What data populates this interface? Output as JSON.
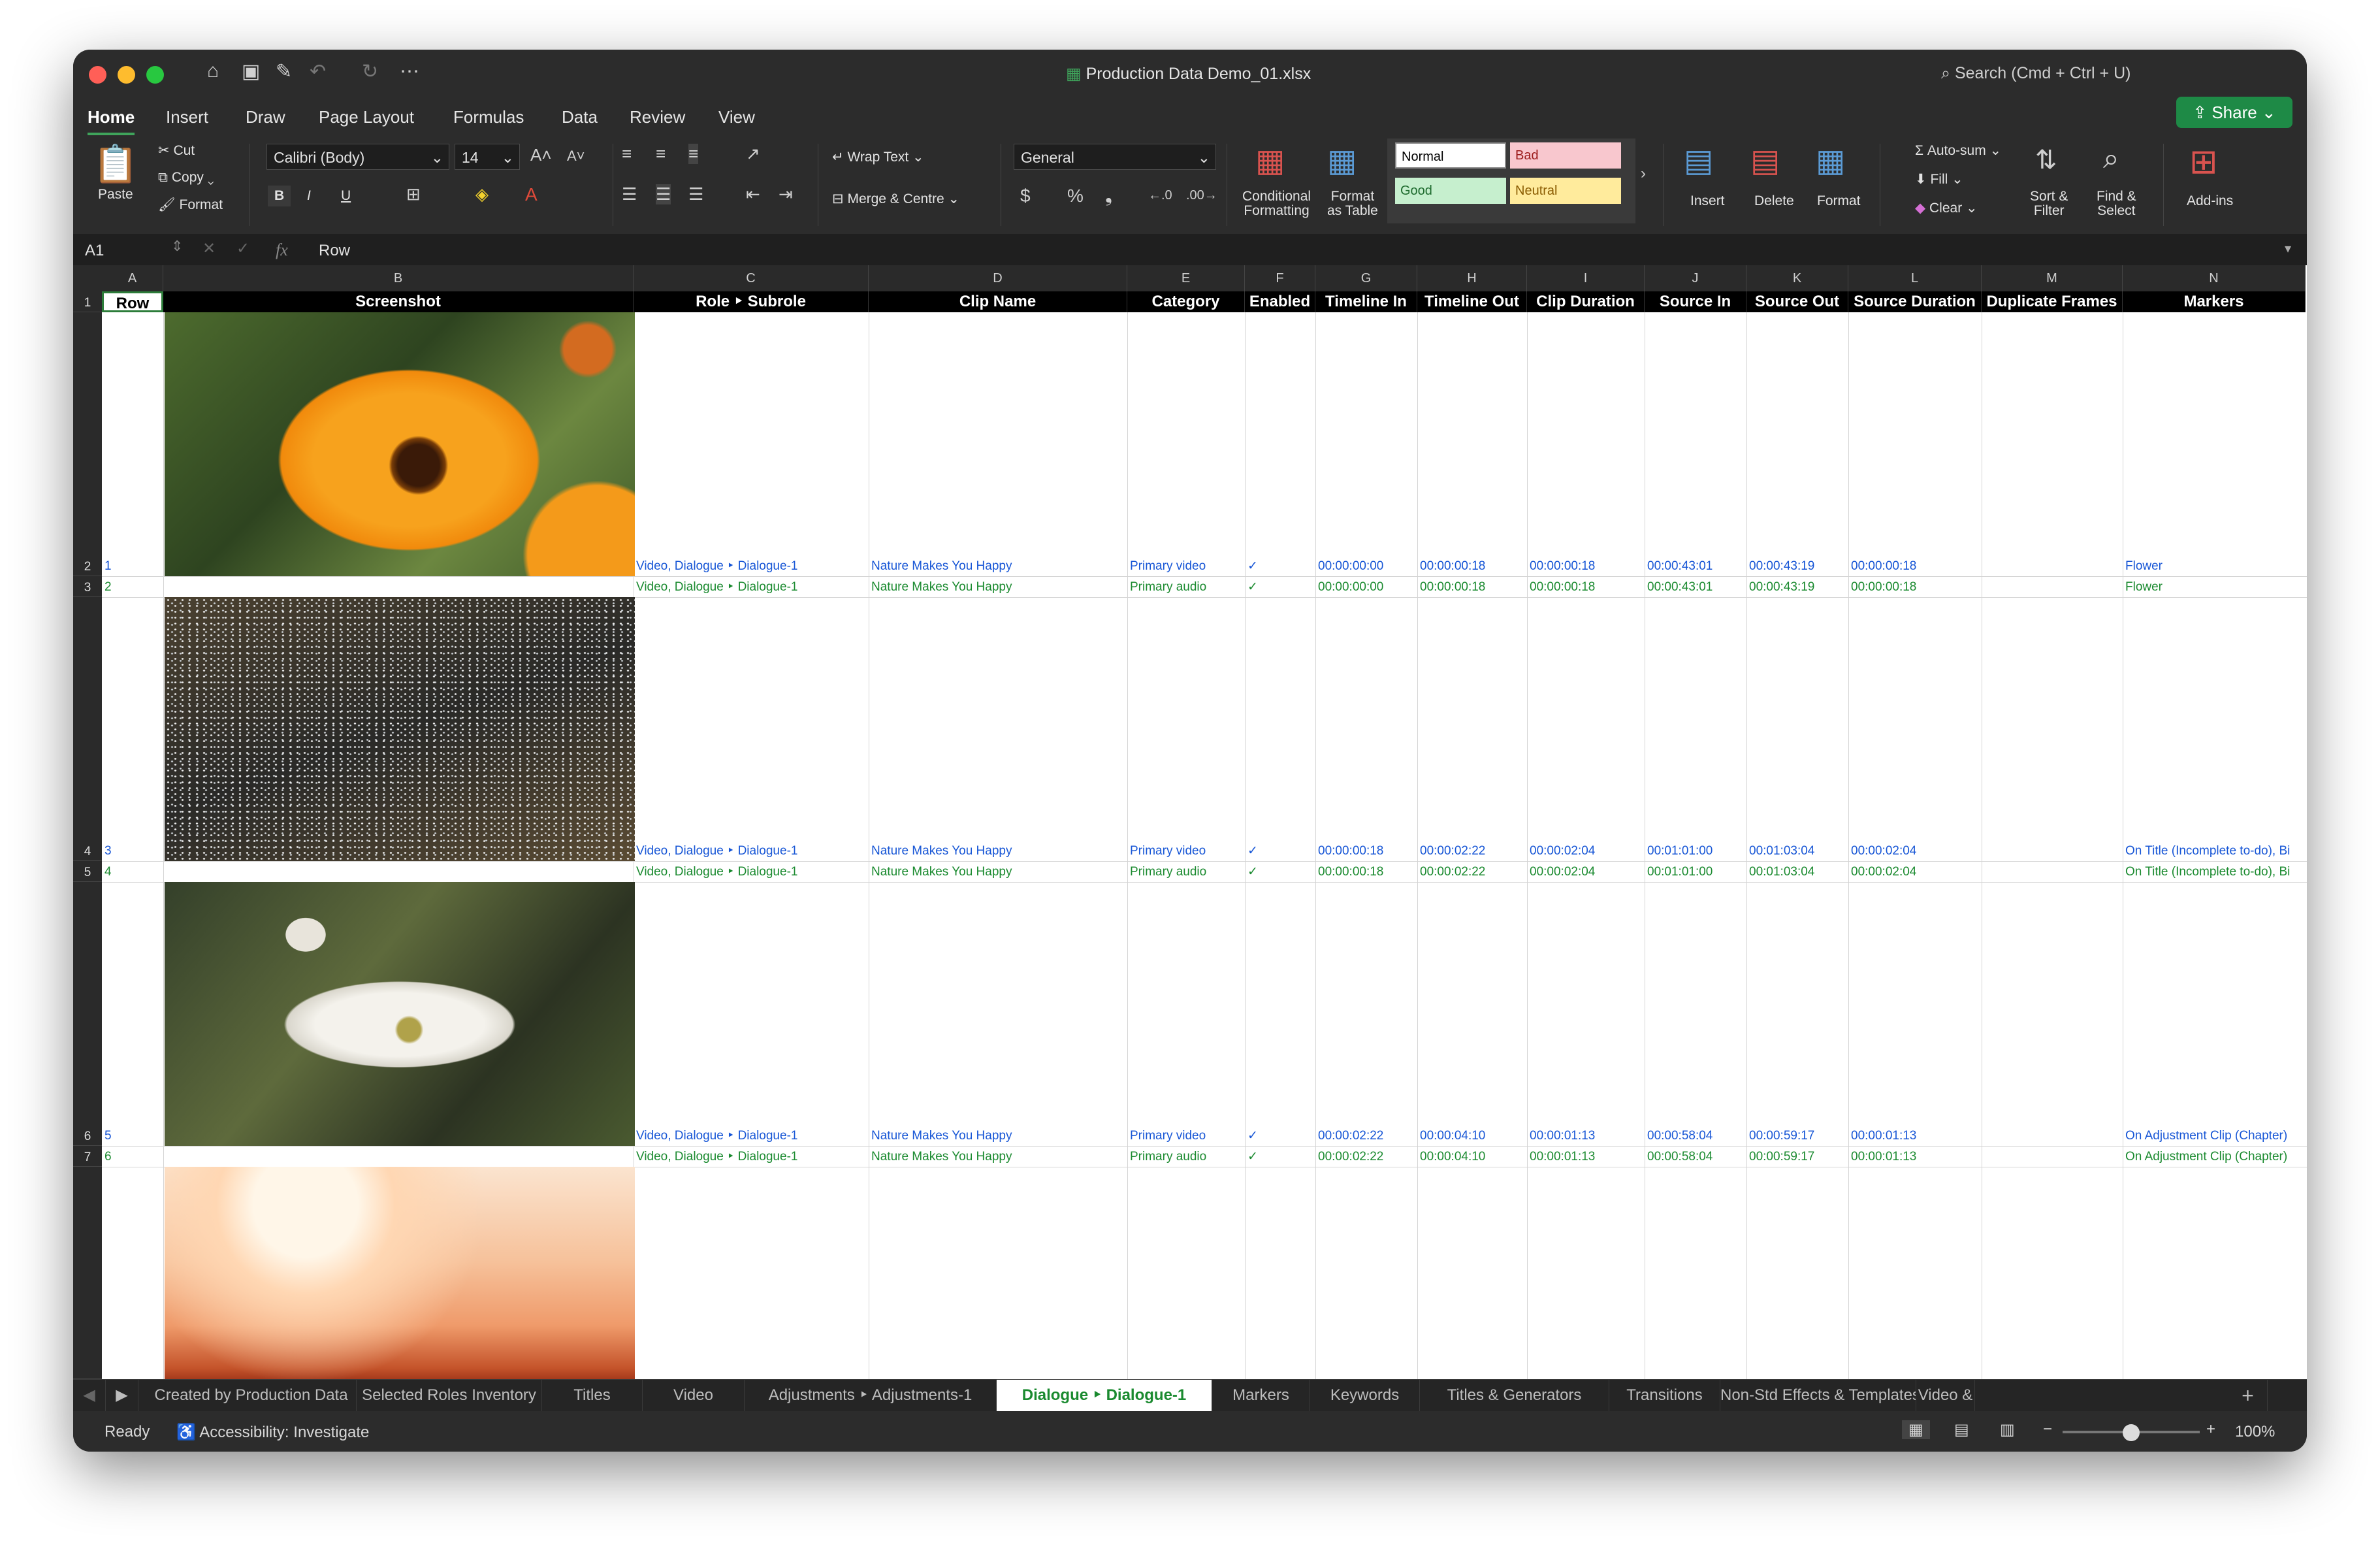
{
  "window": {
    "title": "Production Data Demo_01.xlsx",
    "search_placeholder": "Search (Cmd + Ctrl + U)"
  },
  "menu_tabs": [
    "Home",
    "Insert",
    "Draw",
    "Page Layout",
    "Formulas",
    "Data",
    "Review",
    "View"
  ],
  "share_label": "Share",
  "ribbon": {
    "paste": "Paste",
    "cut": "Cut",
    "copy": "Copy",
    "format": "Format",
    "font_name": "Calibri (Body)",
    "font_size": "14",
    "bold": "B",
    "italic": "I",
    "underline": "U",
    "wrap_text": "Wrap Text",
    "merge_centre": "Merge & Centre",
    "number_format": "General",
    "currency": "$",
    "percent": "%",
    "comma": "❟",
    "conditional_formatting": [
      "Conditional",
      "Formatting"
    ],
    "format_as_table": [
      "Format",
      "as Table"
    ],
    "styles": {
      "normal": "Normal",
      "bad": "Bad",
      "good": "Good",
      "neutral": "Neutral"
    },
    "insert": "Insert",
    "delete": "Delete",
    "format_cells": "Format",
    "autosum": "Auto-sum",
    "fill": "Fill",
    "clear": "Clear",
    "sort_filter": [
      "Sort &",
      "Filter"
    ],
    "find_select": [
      "Find &",
      "Select"
    ],
    "addins": "Add-ins"
  },
  "formula_bar": {
    "name_box": "A1",
    "fx": "fx",
    "value": "Row"
  },
  "column_letters": [
    "A",
    "B",
    "C",
    "D",
    "E",
    "F",
    "G",
    "H",
    "I",
    "J",
    "K",
    "L",
    "M",
    "N"
  ],
  "headers": [
    "Row",
    "Screenshot",
    "Role ‣ Subrole",
    "Clip Name",
    "Category",
    "Enabled",
    "Timeline In",
    "Timeline Out",
    "Clip Duration",
    "Source In",
    "Source Out",
    "Source Duration",
    "Duplicate Frames",
    "Markers"
  ],
  "row_numbers": [
    "1",
    "2",
    "3",
    "4",
    "5",
    "6",
    "7"
  ],
  "rows": [
    {
      "cls": "blue",
      "cells": [
        "1",
        "",
        "Video, Dialogue ‣ Dialogue-1",
        "Nature Makes You Happy",
        "Primary video",
        "✓",
        "00:00:00:00",
        "00:00:00:18",
        "00:00:00:18",
        "00:00:43:01",
        "00:00:43:19",
        "00:00:00:18",
        "",
        "Flower"
      ]
    },
    {
      "cls": "green",
      "cells": [
        "2",
        "",
        "Video, Dialogue ‣ Dialogue-1",
        "Nature Makes You Happy",
        "Primary audio",
        "✓",
        "00:00:00:00",
        "00:00:00:18",
        "00:00:00:18",
        "00:00:43:01",
        "00:00:43:19",
        "00:00:00:18",
        "",
        "Flower"
      ]
    },
    {
      "cls": "blue",
      "cells": [
        "3",
        "",
        "Video, Dialogue ‣ Dialogue-1",
        "Nature Makes You Happy",
        "Primary video",
        "✓",
        "00:00:00:18",
        "00:00:02:22",
        "00:00:02:04",
        "00:01:01:00",
        "00:01:03:04",
        "00:00:02:04",
        "",
        "On Title (Incomplete to-do), Bi"
      ]
    },
    {
      "cls": "green",
      "cells": [
        "4",
        "",
        "Video, Dialogue ‣ Dialogue-1",
        "Nature Makes You Happy",
        "Primary audio",
        "✓",
        "00:00:00:18",
        "00:00:02:22",
        "00:00:02:04",
        "00:01:01:00",
        "00:01:03:04",
        "00:00:02:04",
        "",
        "On Title (Incomplete to-do), Bi"
      ]
    },
    {
      "cls": "blue",
      "cells": [
        "5",
        "",
        "Video, Dialogue ‣ Dialogue-1",
        "Nature Makes You Happy",
        "Primary video",
        "✓",
        "00:00:02:22",
        "00:00:04:10",
        "00:00:01:13",
        "00:00:58:04",
        "00:00:59:17",
        "00:00:01:13",
        "",
        "On Adjustment Clip (Chapter)"
      ]
    },
    {
      "cls": "green",
      "cells": [
        "6",
        "",
        "Video, Dialogue ‣ Dialogue-1",
        "Nature Makes You Happy",
        "Primary audio",
        "✓",
        "00:00:02:22",
        "00:00:04:10",
        "00:00:01:13",
        "00:00:58:04",
        "00:00:59:17",
        "00:00:01:13",
        "",
        "On Adjustment Clip (Chapter)"
      ]
    }
  ],
  "sheet_tabs": [
    "Created by Production Data",
    "Selected Roles Inventory",
    "Titles",
    "Video",
    "Adjustments ‣ Adjustments-1",
    "Dialogue ‣ Dialogue-1",
    "Markers",
    "Keywords",
    "Titles & Generators",
    "Transitions",
    "Non-Std Effects & Templates",
    "Video &"
  ],
  "active_sheet": "Dialogue ‣ Dialogue-1",
  "status": {
    "ready": "Ready",
    "accessibility": "Accessibility: Investigate",
    "zoom": "100%",
    "zoom_level": 0.5
  }
}
